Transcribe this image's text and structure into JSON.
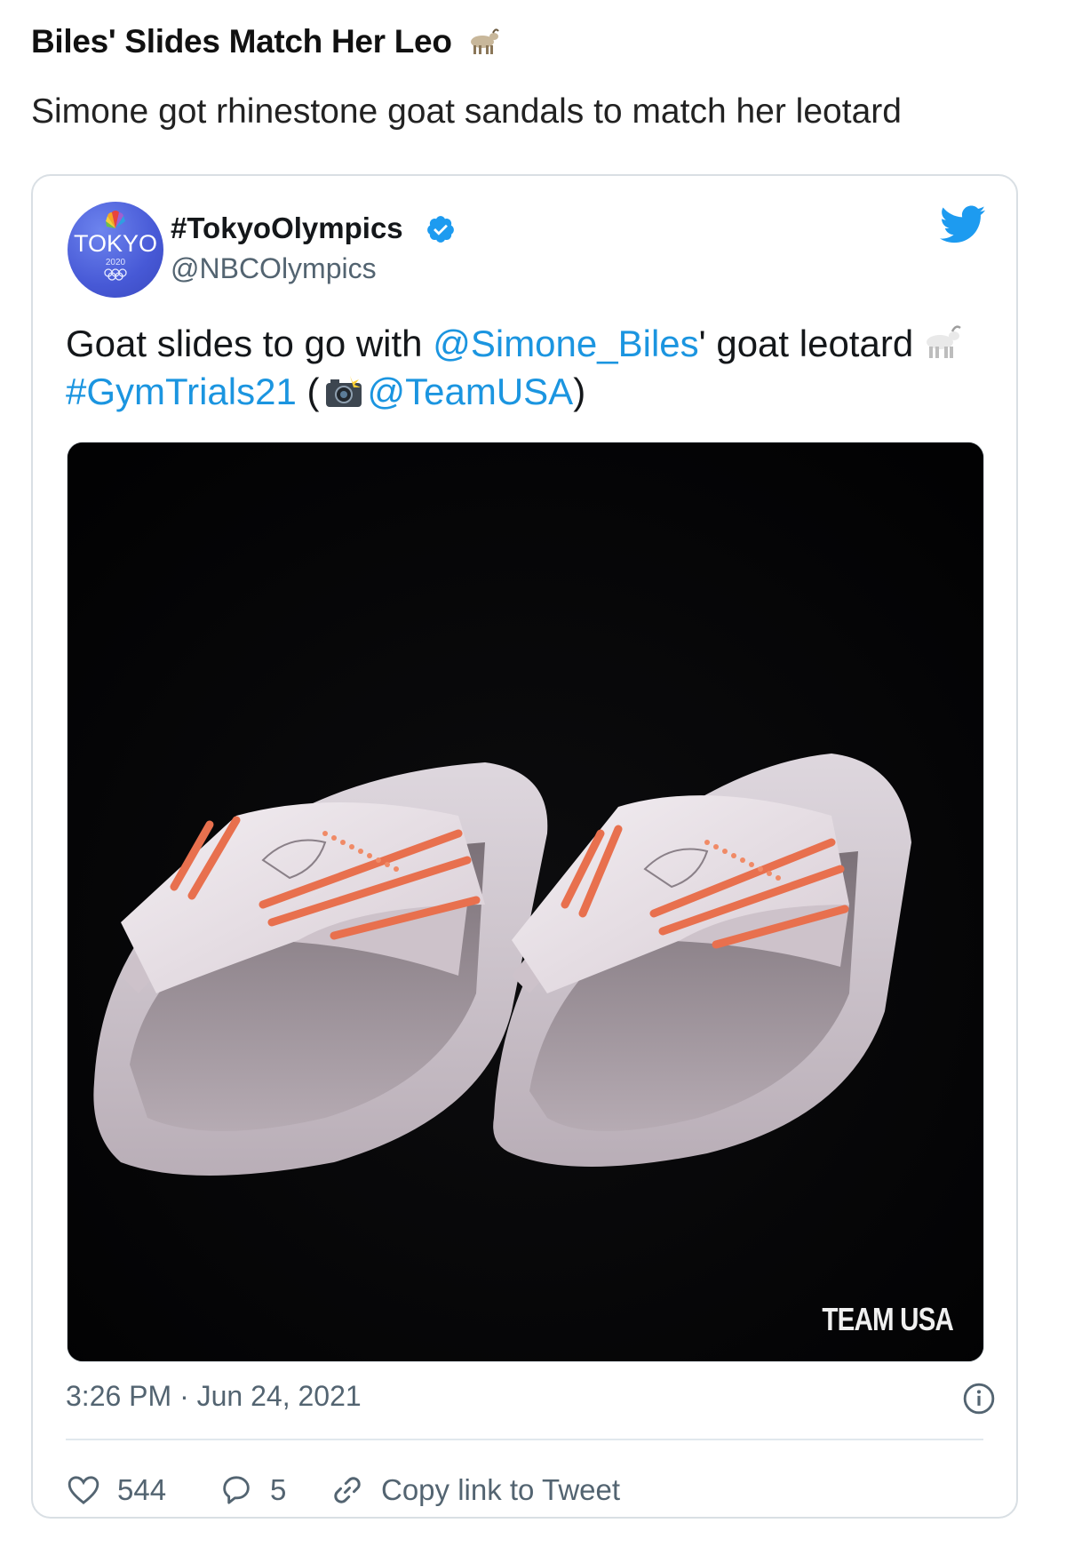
{
  "article": {
    "title": "Biles' Slides Match Her Leo",
    "subtitle": "Simone got rhinestone goat sandals to match her leotard"
  },
  "tweet": {
    "display_name": "#TokyoOlympics",
    "handle": "@NBCOlympics",
    "avatar_text": "TOKYO",
    "avatar_year": "2020",
    "text_parts": {
      "p1": "Goat slides to go with ",
      "mention1": "@Simone_Biles",
      "p2": "' goat leotard",
      "hashtag": "#GymTrials21",
      "p3": " (",
      "mention2": "@TeamUSA",
      "p4": ")"
    },
    "media_watermark": "TEAM USA",
    "timestamp": "3:26 PM · Jun 24, 2021",
    "likes": "544",
    "replies": "5",
    "copy_link_label": "Copy link to Tweet"
  },
  "icons": {
    "title_emoji": "goat-emoji-icon",
    "verified": "verified-badge-icon",
    "brand": "twitter-bird-icon",
    "like": "heart-icon",
    "reply": "reply-bubble-icon",
    "copy": "link-icon",
    "info": "info-icon"
  },
  "colors": {
    "link": "#1b95e0",
    "verified": "#1d9bf0",
    "twitter_blue": "#1d9bf0",
    "muted_text": "#536471",
    "card_border": "#d9dfe4"
  }
}
